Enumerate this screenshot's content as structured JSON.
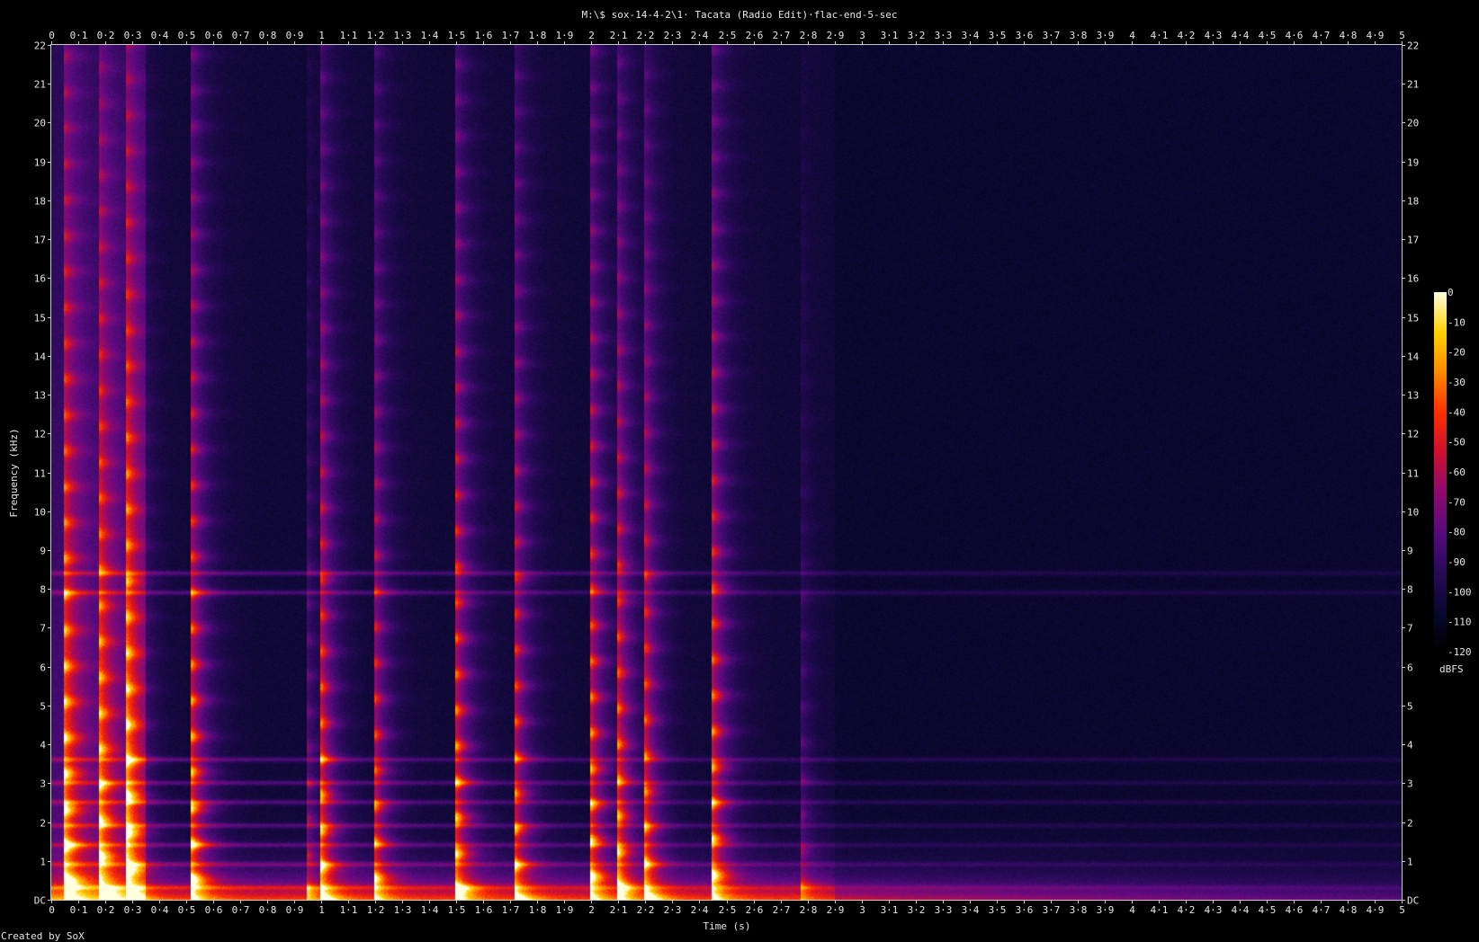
{
  "chart_data": {
    "type": "heatmap",
    "title": "M:\\$ sox-14-4-2\\1· Tacata (Radio Edit)·flac-end-5-sec",
    "xlabel": "Time (s)",
    "ylabel": "Frequency (kHz)",
    "credit": "Created by SoX",
    "xlim": [
      0,
      5
    ],
    "ylim": [
      0,
      22
    ],
    "x_ticks": [
      "0",
      "0·1",
      "0·2",
      "0·3",
      "0·4",
      "0·5",
      "0·6",
      "0·7",
      "0·8",
      "0·9",
      "1",
      "1·1",
      "1·2",
      "1·3",
      "1·4",
      "1·5",
      "1·6",
      "1·7",
      "1·8",
      "1·9",
      "2",
      "2·1",
      "2·2",
      "2·3",
      "2·4",
      "2·5",
      "2·6",
      "2·7",
      "2·8",
      "2·9",
      "3",
      "3·1",
      "3·2",
      "3·3",
      "3·4",
      "3·5",
      "3·6",
      "3·7",
      "3·8",
      "3·9",
      "4",
      "4·1",
      "4·2",
      "4·3",
      "4·4",
      "4·5",
      "4·6",
      "4·7",
      "4·8",
      "4·9",
      "5"
    ],
    "y_ticks": [
      "DC",
      "1",
      "2",
      "3",
      "4",
      "5",
      "6",
      "7",
      "8",
      "9",
      "10",
      "11",
      "12",
      "13",
      "14",
      "15",
      "16",
      "17",
      "18",
      "19",
      "20",
      "21",
      "22"
    ],
    "colorbar": {
      "label": "dBFS",
      "range": [
        -120,
        0
      ],
      "ticks": [
        "0",
        "-10",
        "-20",
        "-30",
        "-40",
        "-50",
        "-60",
        "-70",
        "-80",
        "-90",
        "-100",
        "-110",
        "-120"
      ],
      "colors": [
        "#000000",
        "#0a0830",
        "#2a0a5a",
        "#5a0a80",
        "#900a70",
        "#d01030",
        "#ff3000",
        "#ff8a00",
        "#ffd200",
        "#ffffe0"
      ]
    },
    "onsets_s": [
      0.05,
      0.18,
      0.28,
      0.52,
      0.95,
      1.0,
      1.2,
      1.5,
      1.72,
      2.0,
      2.1,
      2.2,
      2.45,
      2.78
    ],
    "onset_strength": [
      1.0,
      0.9,
      1.0,
      1.0,
      0.45,
      0.85,
      0.8,
      0.95,
      0.85,
      0.95,
      0.85,
      0.8,
      0.95,
      0.35
    ],
    "sustained_bands_khz": [
      0.3,
      0.9,
      1.4,
      1.9,
      2.5,
      3.0,
      3.6,
      7.9,
      8.4
    ],
    "grid": false
  }
}
